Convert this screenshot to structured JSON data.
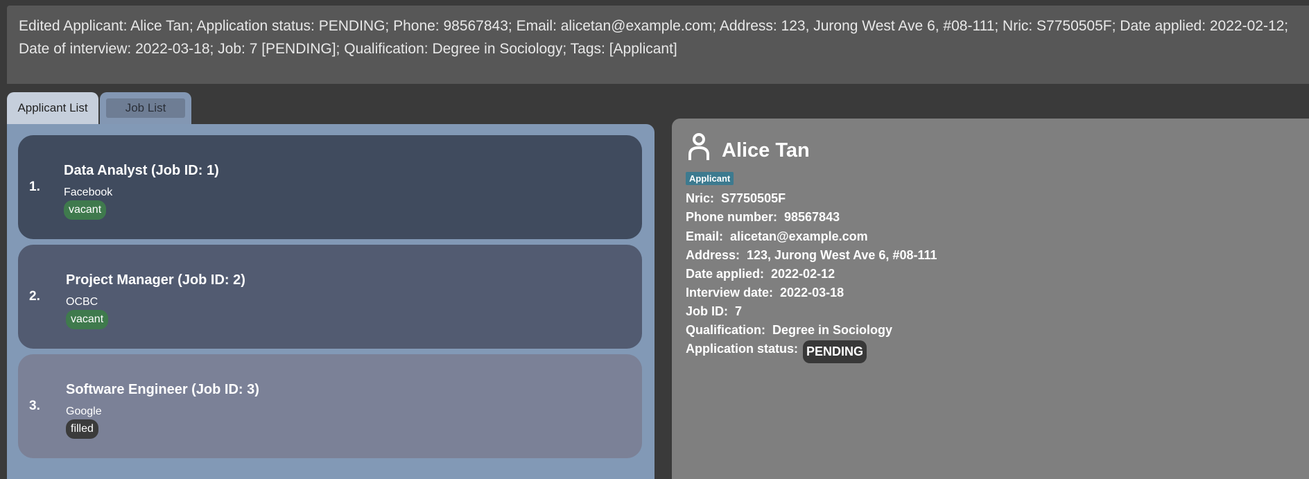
{
  "result": {
    "message": "Edited Applicant: Alice Tan; Application status: PENDING; Phone: 98567843; Email: alicetan@example.com; Address: 123, Jurong West Ave 6, #08-111; Nric: S7750505F; Date applied: 2022-02-12; Date of interview: 2022-03-18; Job: 7 [PENDING]; Qualification: Degree in Sociology; Tags: [Applicant]"
  },
  "tabs": [
    {
      "label": "Applicant List",
      "selected": true
    },
    {
      "label": "Job List",
      "selected": false
    }
  ],
  "jobs": [
    {
      "index": "1.",
      "title": "Data Analyst (Job ID: 1)",
      "company": "Facebook",
      "status": "vacant"
    },
    {
      "index": "2.",
      "title": "Project Manager (Job ID: 2)",
      "company": "OCBC",
      "status": "vacant"
    },
    {
      "index": "3.",
      "title": "Software Engineer (Job ID: 3)",
      "company": "Google",
      "status": "filled"
    }
  ],
  "applicant": {
    "name": "Alice Tan",
    "tag": "Applicant",
    "fields": {
      "nric": "Nric:  S7750505F",
      "phone": "Phone number:  98567843",
      "email": "Email:  alicetan@example.com",
      "address": "Address:  123, Jurong West Ave 6, #08-111",
      "date_applied": "Date applied:  2022-02-12",
      "interview_date": "Interview date:  2022-03-18",
      "job_id": "Job ID:  7",
      "qualification": "Qualification:  Degree in Sociology",
      "status_label": "Application status:"
    },
    "status": "PENDING"
  },
  "colors": {
    "card_1": "#404b5e",
    "card_2": "#525b71",
    "card_3": "#7b8197",
    "vacant": "#3f7a4d",
    "filled": "#3b3b3b",
    "tag": "#3d7a8f"
  },
  "icons": {
    "person": "person-icon"
  }
}
